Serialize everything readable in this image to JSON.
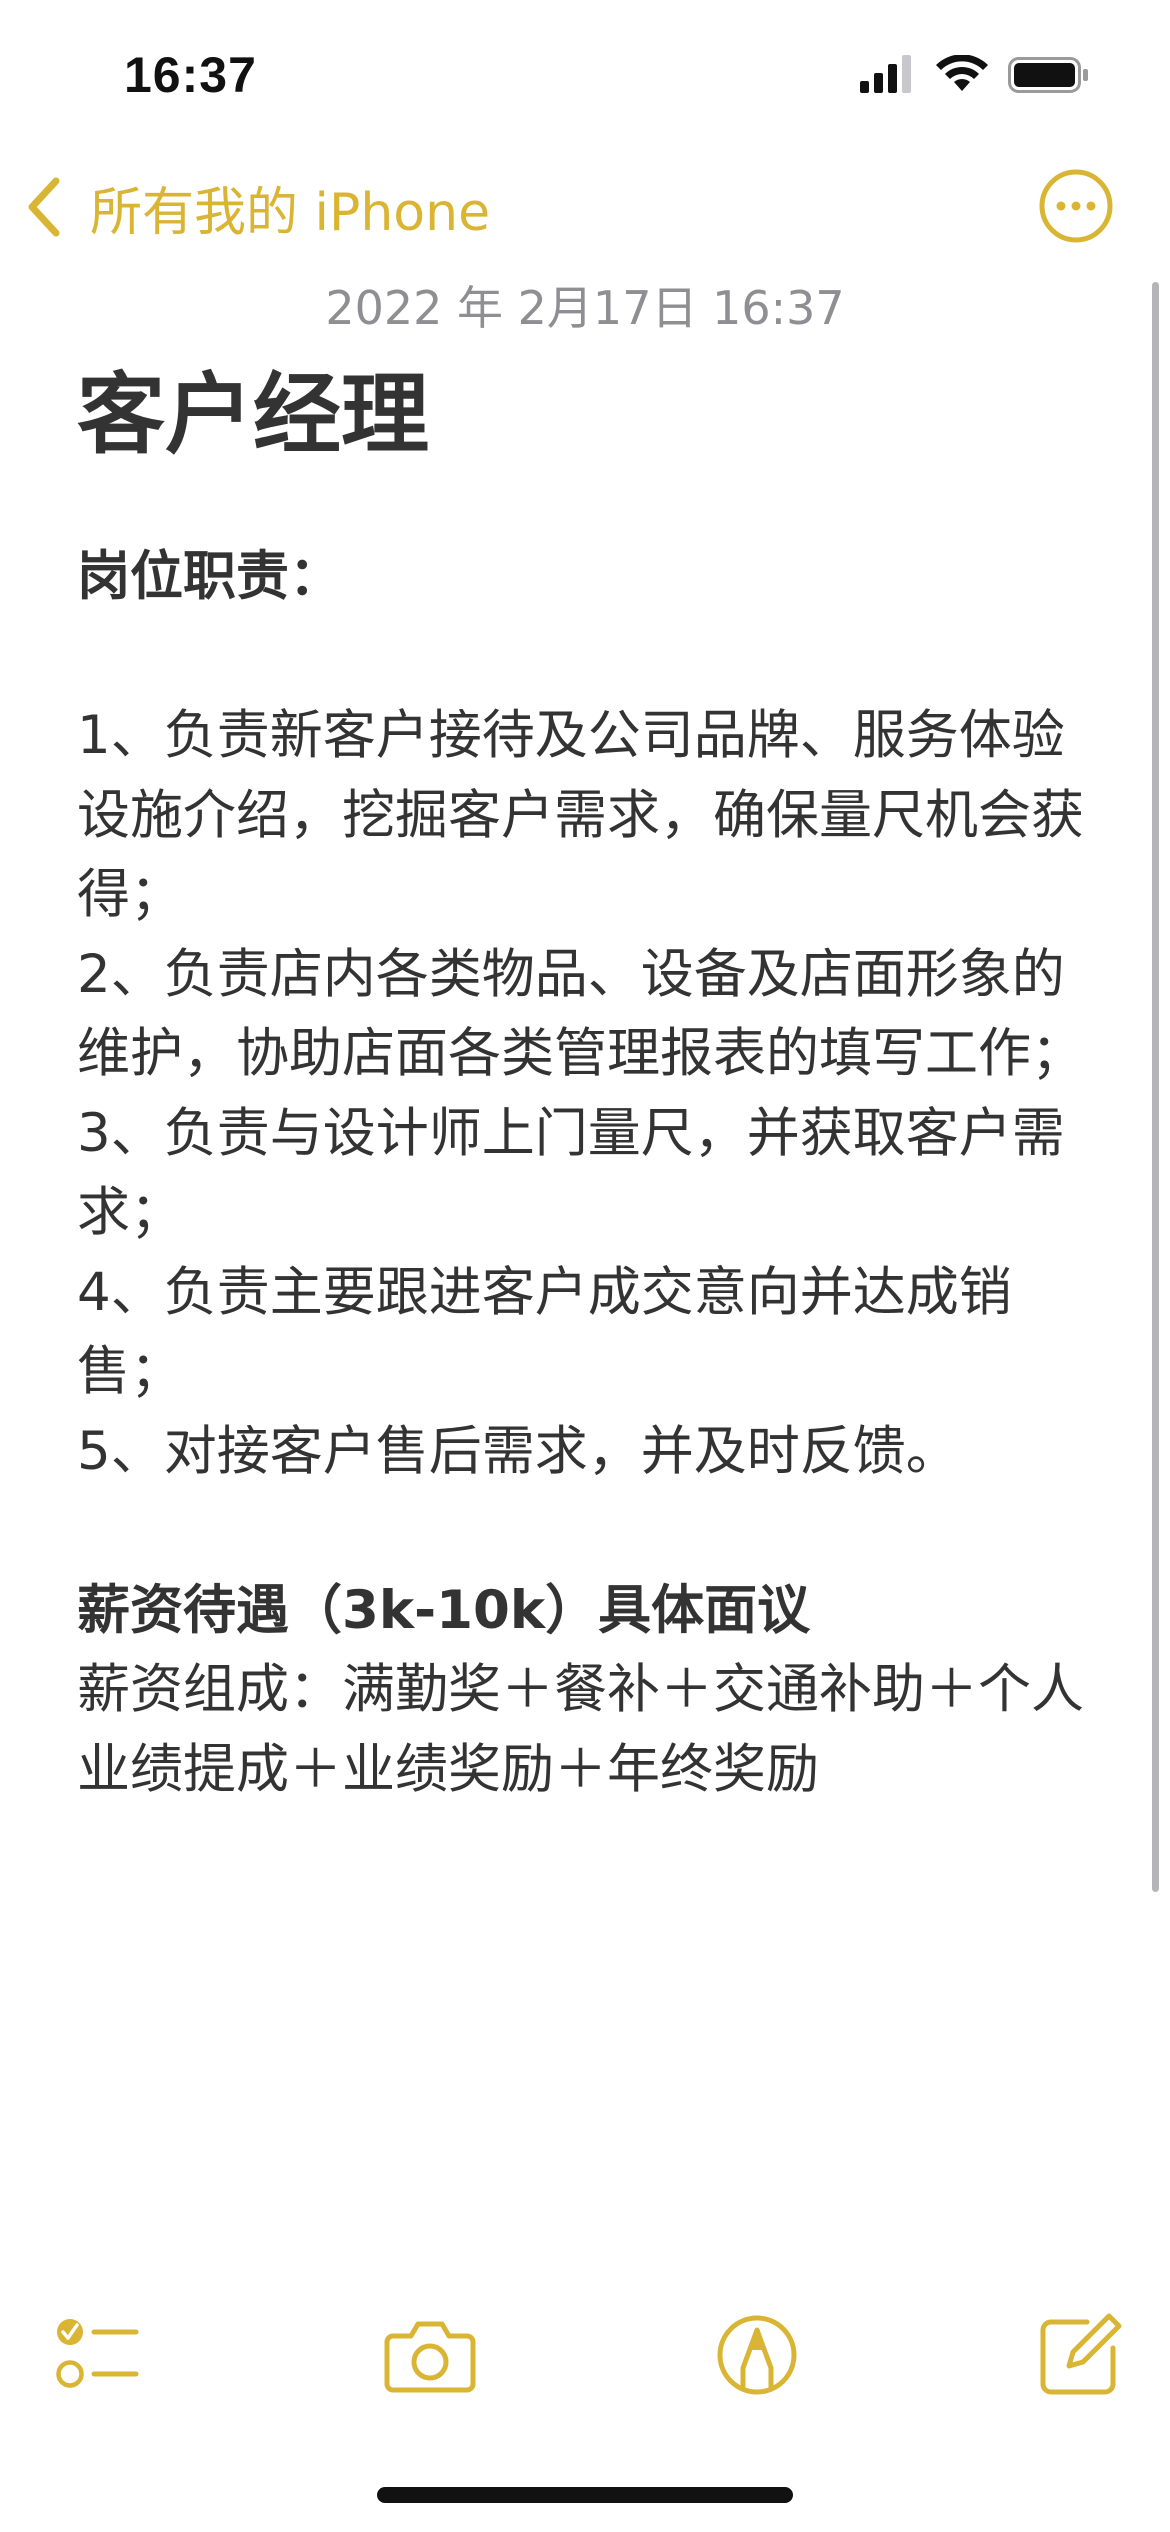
{
  "status_bar": {
    "time": "16:37"
  },
  "nav": {
    "back_label": "所有我的 iPhone",
    "accent_color": "#d9b533"
  },
  "note": {
    "date": "2022 年 2月17日 16:37",
    "title": "客户经理",
    "section1_heading": "岗位职责：",
    "items": [
      "1、负责新客户接待及公司品牌、服务体验设施介绍，挖掘客户需求，确保量尺机会获得；",
      "2、负责店内各类物品、设备及店面形象的维护，协助店面各类管理报表的填写工作；",
      "3、负责与设计师上门量尺，并获取客户需求；",
      "4、负责主要跟进客户成交意向并达成销售；",
      "5、对接客户售后需求，并及时反馈。"
    ],
    "salary_heading": "薪资待遇（3k-10k）具体面议",
    "salary_detail": "薪资组成：满勤奖＋餐补＋交通补助＋个人业绩提成＋业绩奖励＋年终奖励"
  },
  "toolbar": {
    "icons": [
      "checklist-icon",
      "camera-icon",
      "markup-icon",
      "compose-icon"
    ]
  }
}
